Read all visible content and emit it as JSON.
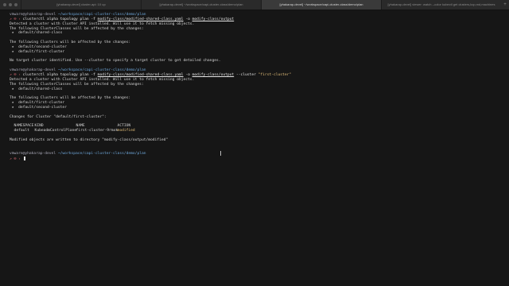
{
  "tabs": [
    {
      "label": "[yhakarap-devel] cluster-api: 10 up"
    },
    {
      "label": "[yhakarap-devel] ~/workspace/capi-cluster-class/demo/plan"
    },
    {
      "label": "[yhakarap-devel] ~/workspace/capi-cluster-class/demo/plan"
    },
    {
      "label": "[yhakarap-devel] viewer: watch --color kubectl get clusters,kcp,md,machines"
    }
  ],
  "terminal": {
    "prompt_user": "vmware@yhakarap-devel",
    "prompt_dir": "~/workspace/capi-cluster-class/demo/plan",
    "prompt_marker": "↗ ⍟ ›",
    "block1": {
      "command": "clusterctl alpha topology plan -f ",
      "file": "modify-class/modified-shared-class.yaml",
      "flag_o": " -o ",
      "out": "modify-class/output",
      "output": [
        "Detected a cluster with Cluster API installed. Will use it to fetch missing objects.",
        "The following ClusterClasses will be affected by the changes:",
        " ★  default/shared-class",
        "",
        "The following Clusters will be affected by the changes:",
        " ★  default/second-cluster",
        " ★  default/first-cluster",
        "",
        "No target cluster identified. Use --cluster to specify a target cluster to get detailed changes."
      ]
    },
    "block2": {
      "command": "clusterctl alpha topology plan -f ",
      "file": "modify-class/modified-shared-class.yaml",
      "flag_o": " -o ",
      "out": "modify-class/output",
      "flag_cluster": " --cluster ",
      "cluster_arg": "\"first-cluster\"",
      "output_top": [
        "Detected a cluster with Cluster API installed. Will use it to fetch missing objects.",
        "The following ClusterClasses will be affected by the changes:",
        " ★  default/shared-class",
        "",
        "The following Clusters will be affected by the changes:",
        " ★  default/first-cluster",
        " ★  default/second-cluster",
        "",
        "Changes for Cluster \"default/first-cluster\":",
        ""
      ],
      "table": {
        "headers": [
          "NAMESPACE",
          "KIND",
          "NAME",
          "ACTION"
        ],
        "rows": [
          [
            "default",
            "KubeadmControlPlane",
            "first-cluster-9rmxk",
            "modified"
          ]
        ]
      },
      "output_bottom": "Modified objects are written to directory \"modify-class/output/modified\""
    },
    "block3": {}
  }
}
